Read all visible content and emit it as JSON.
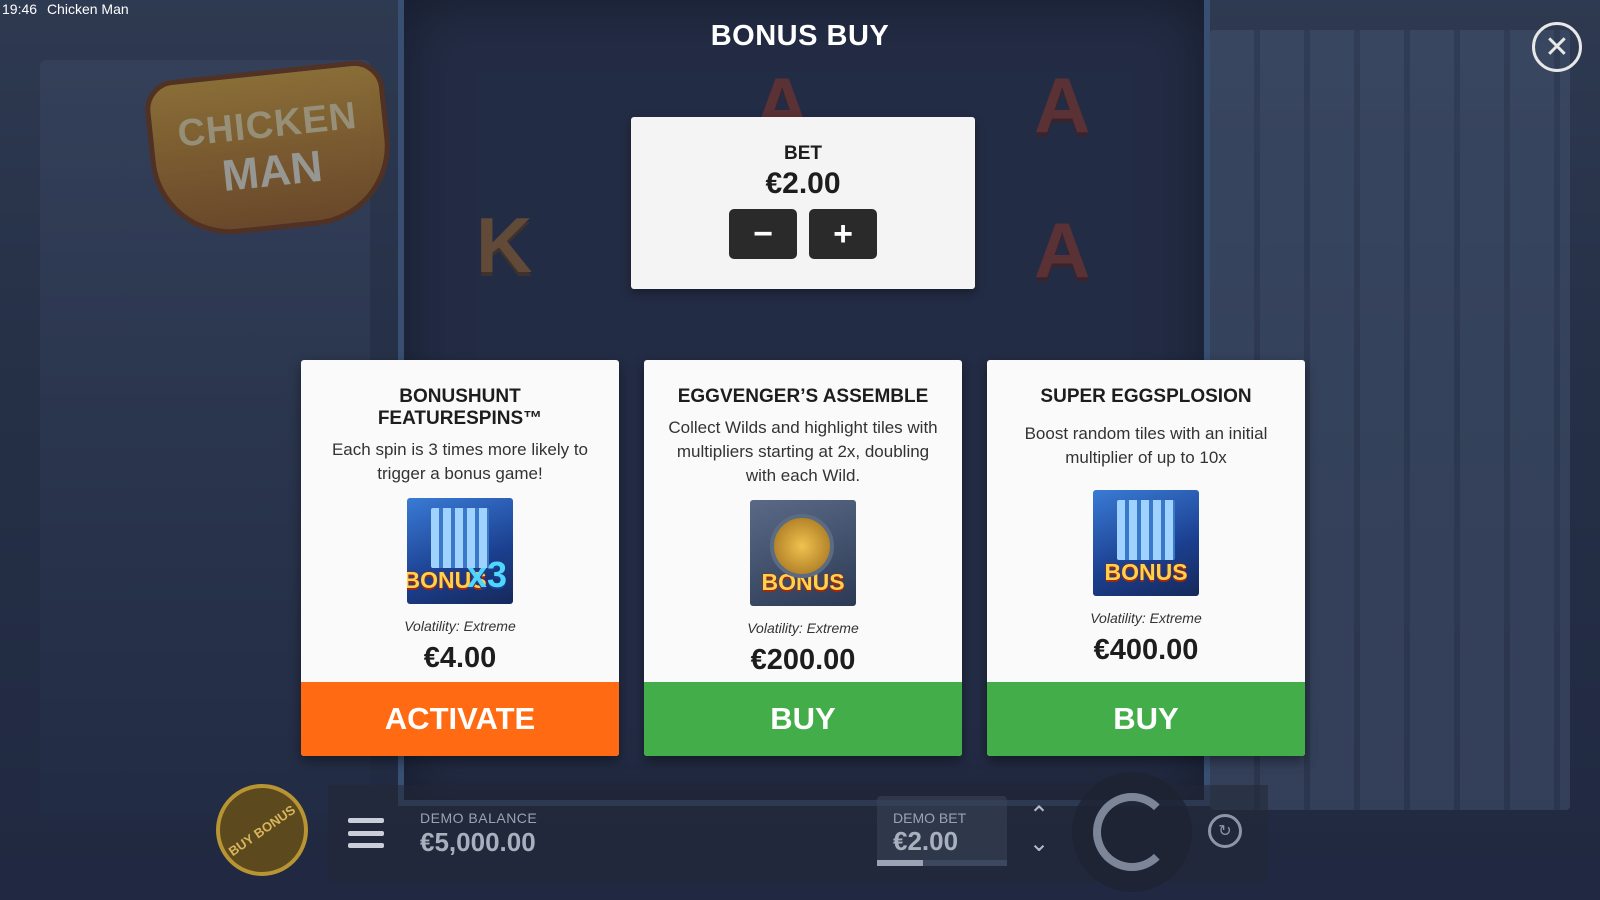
{
  "status_bar": {
    "time": "19:46",
    "app": "Chicken Man"
  },
  "logo": {
    "line1": "CHICKEN",
    "line2": "MAN"
  },
  "reel_symbols": [
    "A",
    "A",
    "K",
    "A"
  ],
  "title": "BONUS BUY",
  "close_icon": "close-icon",
  "bet_panel": {
    "label": "BET",
    "value": "€2.00",
    "minus": "−",
    "plus": "+"
  },
  "cards": [
    {
      "title_line1": "BONUSHUNT",
      "title_line2": "FEATURESPINS™",
      "description": "Each spin is 3 times more likely to trigger a bonus game!",
      "image_text": "BONUS",
      "image_mult": "x3",
      "volatility": "Volatility: Extreme",
      "price": "€4.00",
      "action": "ACTIVATE"
    },
    {
      "title_line1": "EGGVENGER’S ASSEMBLE",
      "title_line2": "",
      "description": "Collect Wilds and highlight tiles with multipliers starting at 2x, doubling with each Wild.",
      "image_text": "BONUS",
      "volatility": "Volatility: Extreme",
      "price": "€200.00",
      "action": "BUY"
    },
    {
      "title_line1": "SUPER EGGSPLOSION",
      "title_line2": "",
      "description": "Boost random tiles with an initial multiplier of up to 10x",
      "image_text": "BONUS",
      "volatility": "Volatility: Extreme",
      "price": "€400.00",
      "action": "BUY"
    }
  ],
  "colors": {
    "activate": "#ff6a12",
    "buy": "#43ad4a"
  },
  "bottom_bar": {
    "buy_bonus": "BUY BONUS",
    "balance_label": "DEMO BALANCE",
    "balance_value": "€5,000.00",
    "bet_label": "DEMO BET",
    "bet_value": "€2.00",
    "bet_level": 0.35,
    "arrow_up": "⌃",
    "arrow_down": "⌄"
  }
}
